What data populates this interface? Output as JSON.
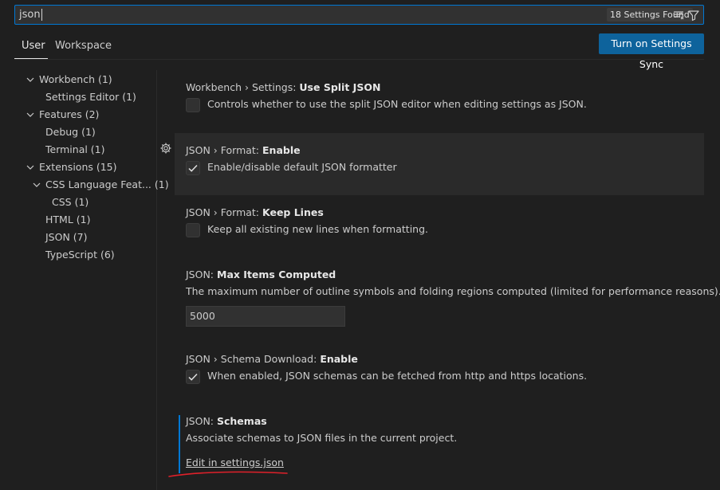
{
  "search": {
    "value": "json",
    "results_count": "18 Settings Found"
  },
  "tabs": [
    {
      "label": "User"
    },
    {
      "label": "Workspace"
    }
  ],
  "sync_button": {
    "label": "Turn on Settings Sync"
  },
  "toc": [
    {
      "label": "Workbench (1)"
    },
    {
      "label": "Settings Editor (1)"
    },
    {
      "label": "Features (2)"
    },
    {
      "label": "Debug (1)"
    },
    {
      "label": "Terminal (1)"
    },
    {
      "label": "Extensions (15)"
    },
    {
      "label": "CSS Language Feat... (1)"
    },
    {
      "label": "CSS (1)"
    },
    {
      "label": "HTML (1)"
    },
    {
      "label": "JSON (7)"
    },
    {
      "label": "TypeScript (6)"
    }
  ],
  "settings": [
    {
      "category": "Workbench › Settings: ",
      "name": "Use Split JSON",
      "description": "Controls whether to use the split JSON editor when editing settings as JSON.",
      "checked": false
    },
    {
      "category": "JSON › Format: ",
      "name": "Enable",
      "description": "Enable/disable default JSON formatter",
      "checked": true
    },
    {
      "category": "JSON › Format: ",
      "name": "Keep Lines",
      "description": "Keep all existing new lines when formatting.",
      "checked": false
    },
    {
      "category": "JSON: ",
      "name": "Max Items Computed",
      "description": "The maximum number of outline symbols and folding regions computed (limited for performance reasons).",
      "value": "5000"
    },
    {
      "category": "JSON › Schema Download: ",
      "name": "Enable",
      "description": "When enabled, JSON schemas can be fetched from http and https locations.",
      "checked": true
    },
    {
      "category": "JSON: ",
      "name": "Schemas",
      "description": "Associate schemas to JSON files in the current project.",
      "link": "Edit in settings.json"
    }
  ],
  "colors": {
    "accent": "#0078d4",
    "button": "#0e639c",
    "annotation": "#e0202a"
  }
}
